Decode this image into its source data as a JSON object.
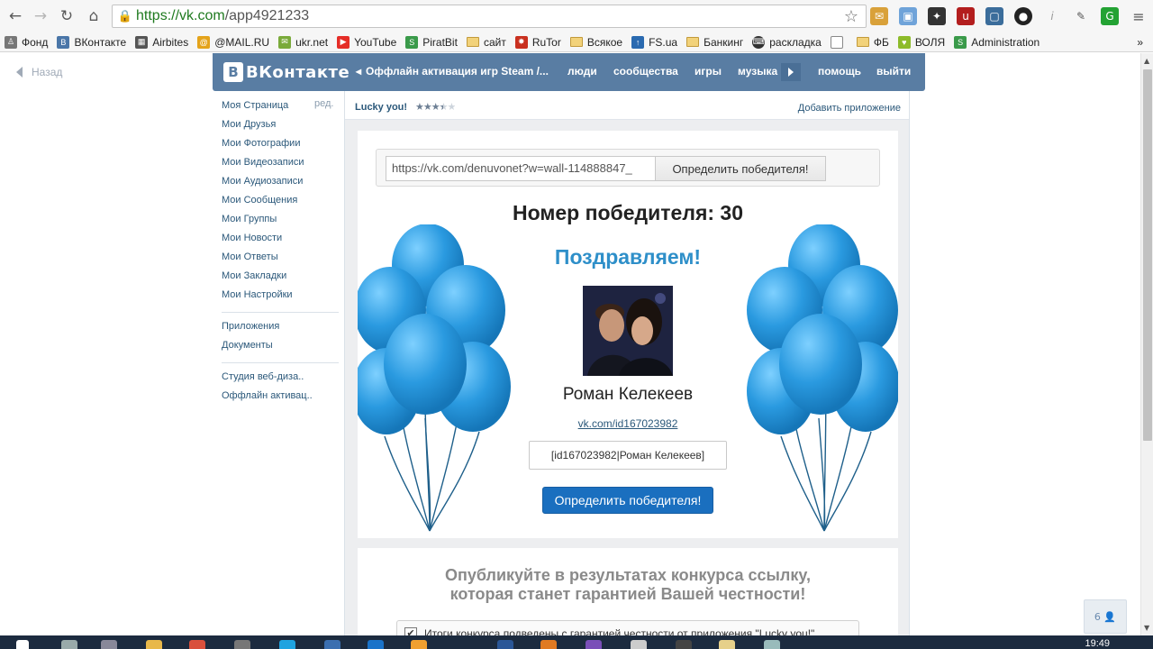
{
  "browser": {
    "url_host": "https://vk.com",
    "url_path": "/app4921233",
    "bookmarks": [
      "Фонд",
      "ВКонтакте",
      "Airbites",
      "@MAIL.RU",
      "ukr.net",
      "YouTube",
      "PiratBit",
      "сайт",
      "RuTor",
      "Всякое",
      "FS.ua",
      "Банкинг",
      "раскладка",
      "ФБ",
      "ВОЛЯ",
      "Administration"
    ],
    "more": "»"
  },
  "nav": {
    "back": "Назад",
    "logo": "ВКонтакте",
    "app_crumb": "Оффлайн активация игр Steam /...",
    "people": "люди",
    "communities": "сообщества",
    "games": "игры",
    "music": "музыка",
    "help": "помощь",
    "logout": "выйти"
  },
  "menu": {
    "edit": "ред.",
    "items": [
      "Моя Страница",
      "Мои Друзья",
      "Мои Фотографии",
      "Мои Видеозаписи",
      "Мои Аудиозаписи",
      "Мои Сообщения",
      "Мои Группы",
      "Мои Новости",
      "Мои Ответы",
      "Мои Закладки",
      "Мои Настройки"
    ],
    "items2": [
      "Приложения",
      "Документы"
    ],
    "items3": [
      "Студия веб-диза..",
      "Оффлайн активац.."
    ]
  },
  "app": {
    "name": "Lucky you!",
    "stars": "★★★★★",
    "rating": 3.5,
    "add": "Добавить приложение",
    "post_url": "https://vk.com/denuvonet?w=wall-114888847_",
    "determine": "Определить победителя!",
    "winner_number": "Номер победителя: 30",
    "congrats": "Поздравляем!",
    "winner_name": "Роман Келекеев",
    "winner_link": "vk.com/id167023982",
    "winner_tag": "[id167023982|Роман Келекеев]",
    "publish_line1": "Опубликуйте в результатах конкурса ссылку,",
    "publish_line2": "которая станет гарантией Вашей честности!",
    "guarantee": "Итоги конкурса подведены с гарантией честности от приложения \"Lucky you!\""
  },
  "online_count": "6",
  "clock": "19:49",
  "colors": {
    "vk_blue": "#597da3",
    "button_blue": "#1a6fbf",
    "congrats": "#2e8fc9"
  }
}
